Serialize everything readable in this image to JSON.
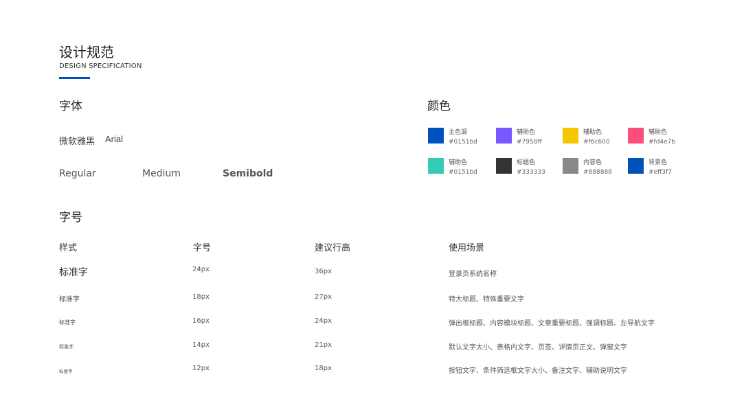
{
  "header": {
    "title": "设计规范",
    "subtitle": "DESIGN SPECIFICATION",
    "accent_color": "#0151bd"
  },
  "font_section": {
    "heading": "字体",
    "families": [
      "微软雅黑",
      "Arial"
    ],
    "weights": [
      "Regular",
      "Medium",
      "Semibold"
    ]
  },
  "color_section": {
    "heading": "颜色",
    "colors": [
      {
        "label": "主色调",
        "hex_label": "#0151bd",
        "color": "#0151bd"
      },
      {
        "label": "辅助色",
        "hex_label": "#7958ff",
        "color": "#7958ff"
      },
      {
        "label": "辅助色",
        "hex_label": "#f6c600",
        "color": "#f6c600"
      },
      {
        "label": "辅助色",
        "hex_label": "#fd4e7b",
        "color": "#fd4e7b"
      },
      {
        "label": "辅助色",
        "hex_label": "#0151bd",
        "color": "#33ccb3"
      },
      {
        "label": "标题色",
        "hex_label": "#333333",
        "color": "#333333"
      },
      {
        "label": "内容色",
        "hex_label": "#888888",
        "color": "#888888"
      },
      {
        "label": "背景色",
        "hex_label": "#eff3f7",
        "color": "#0151bd"
      }
    ]
  },
  "size_section": {
    "heading": "字号",
    "columns": [
      "样式",
      "字号",
      "建议行高",
      "使用场景"
    ],
    "rows": [
      {
        "sample": "标准字",
        "size": "24px",
        "line_height": "36px",
        "usage": "登录页系统名称"
      },
      {
        "sample": "标准字",
        "size": "18px",
        "line_height": "27px",
        "usage": "特大标题、特殊重要文字"
      },
      {
        "sample": "标准字",
        "size": "16px",
        "line_height": "24px",
        "usage": "弹出框标题、内容模块标题、文章重要标题、强调标题、左导航文字"
      },
      {
        "sample": "标准字",
        "size": "14px",
        "line_height": "21px",
        "usage": "默认文字大小、表格内文字、页签、详情页正文、弹窗文字"
      },
      {
        "sample": "标准字",
        "size": "12px",
        "line_height": "18px",
        "usage": "按钮文字、条件筛选框文字大小、备注文字、辅助说明文字"
      }
    ]
  }
}
